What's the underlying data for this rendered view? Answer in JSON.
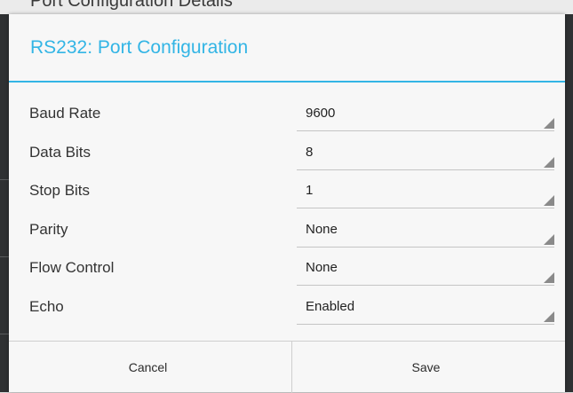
{
  "background": {
    "title": "Port Configuration Details"
  },
  "dialog": {
    "title": "RS232: Port Configuration",
    "accent_color": "#33b5e5",
    "fields": [
      {
        "label": "Baud Rate",
        "value": "9600"
      },
      {
        "label": "Data Bits",
        "value": "8"
      },
      {
        "label": "Stop Bits",
        "value": "1"
      },
      {
        "label": "Parity",
        "value": "None"
      },
      {
        "label": "Flow Control",
        "value": "None"
      },
      {
        "label": "Echo",
        "value": "Enabled"
      }
    ],
    "buttons": {
      "cancel": "Cancel",
      "save": "Save"
    }
  }
}
